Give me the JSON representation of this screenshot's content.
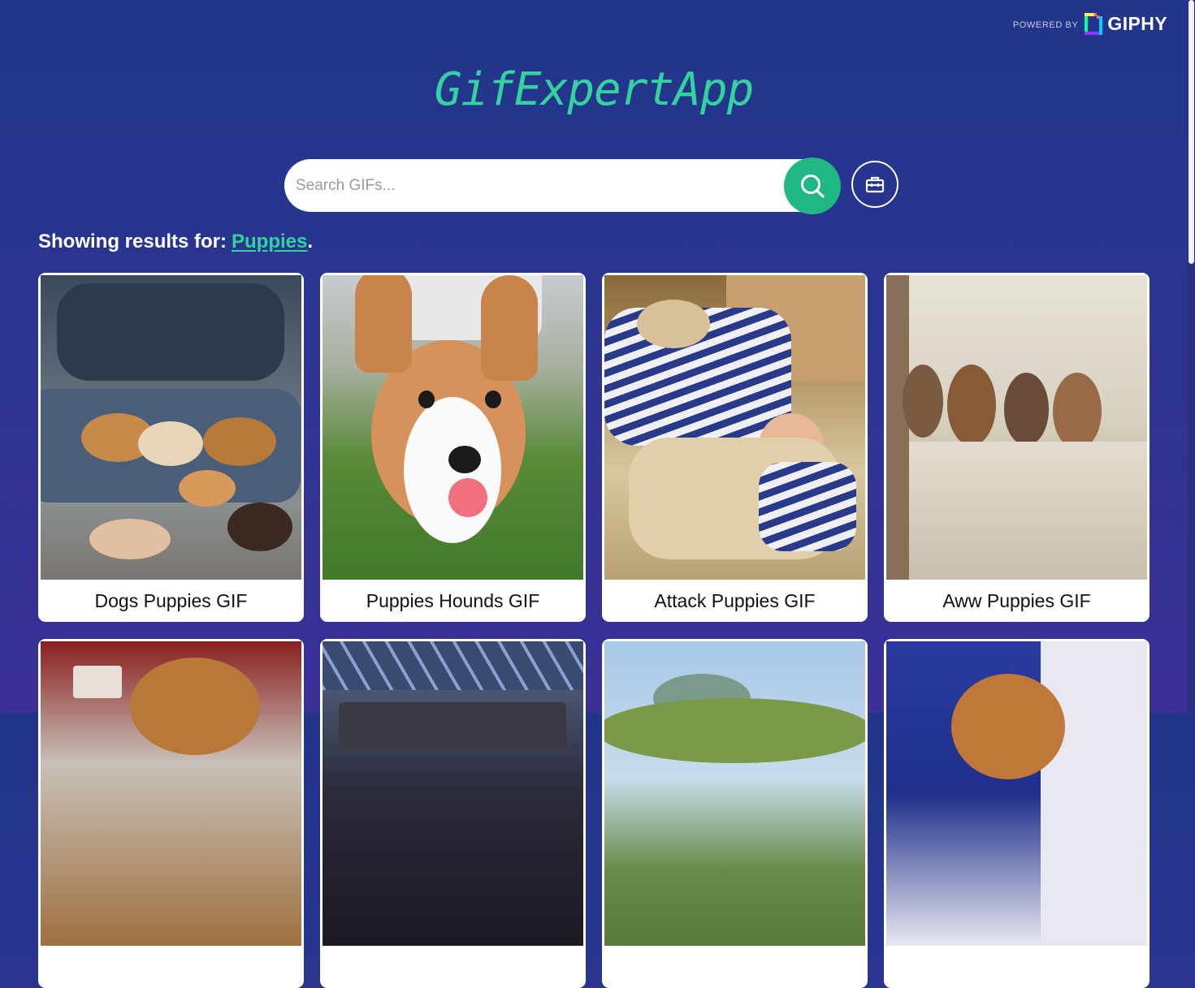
{
  "brand": {
    "powered_by": "POWERED BY",
    "giphy": "GIPHY"
  },
  "app": {
    "title": "GifExpertApp"
  },
  "search": {
    "placeholder": "Search GIFs...",
    "value": "",
    "button_icon": "search-icon",
    "tool_icon": "toolbox-icon"
  },
  "results": {
    "prefix": "Showing results for:",
    "query": "Puppies",
    "suffix": "."
  },
  "colors": {
    "accent": "#34d29e",
    "search_button": "#1fb882",
    "background_top": "#21358a",
    "background_bottom": "#3b3096"
  },
  "gifs": [
    {
      "title": "Dogs Puppies GIF"
    },
    {
      "title": "Puppies Hounds GIF"
    },
    {
      "title": "Attack Puppies GIF"
    },
    {
      "title": "Aww Puppies GIF"
    },
    {
      "title": ""
    },
    {
      "title": ""
    },
    {
      "title": ""
    },
    {
      "title": ""
    }
  ]
}
